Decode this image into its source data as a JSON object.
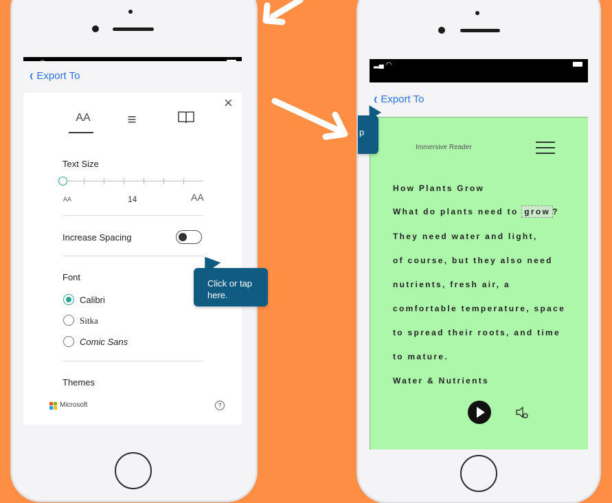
{
  "left_phone": {
    "back_label": "Export To",
    "close_glyph": "×",
    "toolbar": {
      "text_size_glyph": "AA",
      "grammar_glyph": "≡",
      "book_glyph": "📖"
    },
    "text_size": {
      "label": "Text Size",
      "small_glyph": "AA",
      "large_glyph": "AA",
      "value": "14"
    },
    "spacing": {
      "label": "Increase Spacing",
      "enabled": false
    },
    "tooltip": {
      "line1": "Click or tap",
      "line2": "here."
    },
    "font": {
      "label": "Font",
      "options": [
        {
          "label": "Calibri",
          "selected": true
        },
        {
          "label": "Sitka",
          "selected": false
        },
        {
          "label": "Comic Sans",
          "selected": false
        }
      ]
    },
    "themes_label": "Themes",
    "footer_brand": "Microsoft",
    "help_glyph": "?"
  },
  "right_phone": {
    "back_label": "Export To",
    "title": "Immersive Reader",
    "tooltip_fragment": "p",
    "lines": [
      "How Plants Grow",
      "What do plants need to",
      "They need water and light,",
      "of course, but they also need",
      "nutrients, fresh air, a",
      "comfortable temperature, space",
      "to spread their roots, and time",
      "to mature.",
      "Water & Nutrients"
    ],
    "highlight_word": "grow",
    "highlight_suffix": "?"
  },
  "colors": {
    "background": "#FF8E45",
    "accent_blue": "#2A72E6",
    "tooltip_blue": "#0F5B82",
    "reader_green": "#ADF7AB",
    "radio_teal": "#2AA394"
  },
  "icons": [
    "chevron-left-icon",
    "close-icon",
    "text-size-icon",
    "grammar-options-icon",
    "book-icon",
    "help-icon",
    "hamburger-menu-icon",
    "play-icon",
    "voice-settings-icon",
    "microsoft-logo-icon"
  ]
}
